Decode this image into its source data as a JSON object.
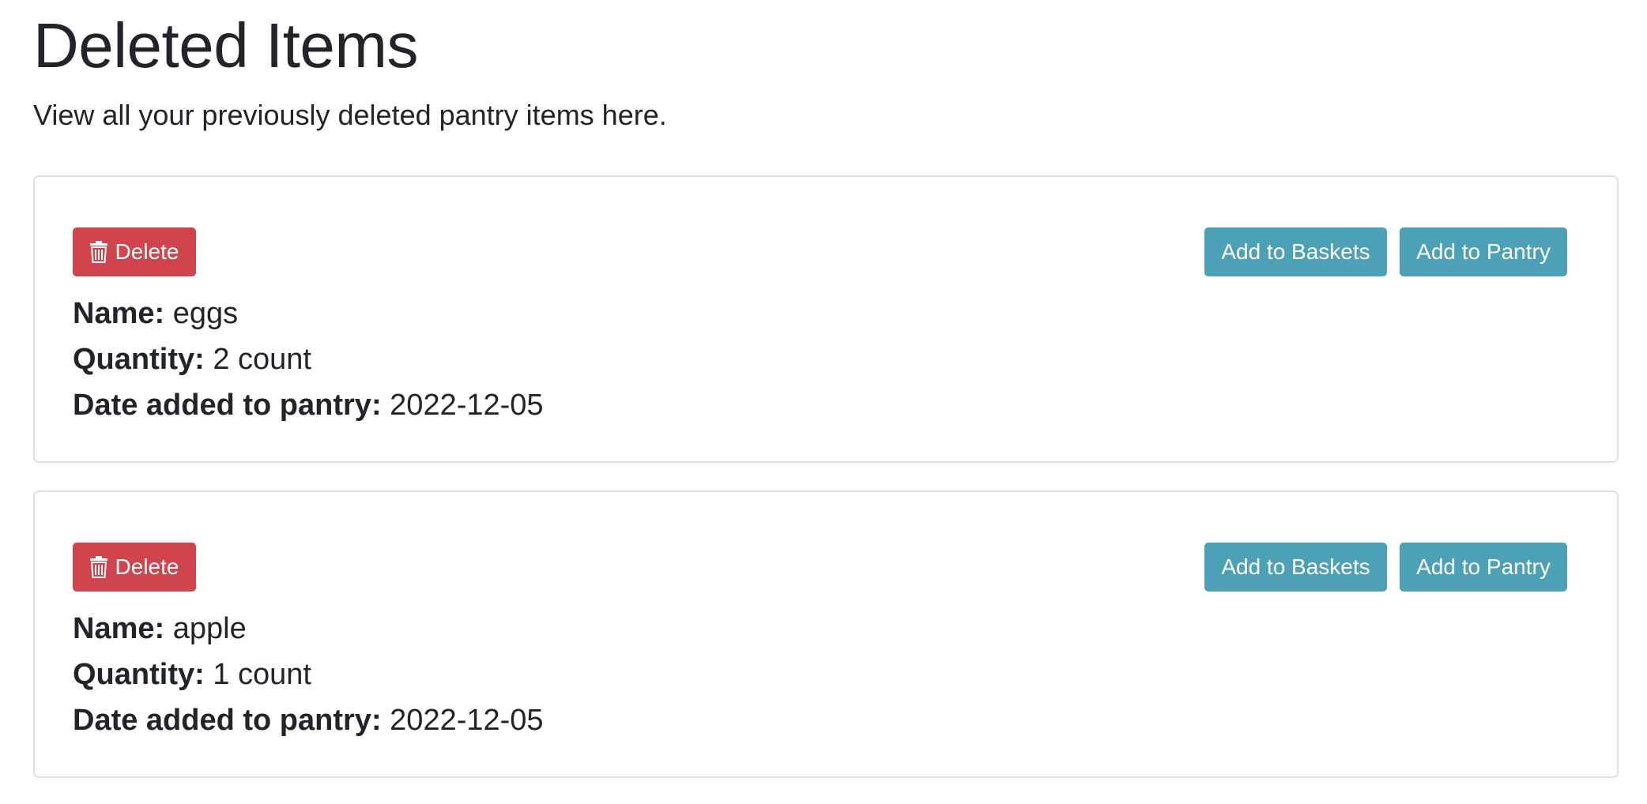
{
  "page": {
    "title": "Deleted Items",
    "subtitle": "View all your previously deleted pantry items here."
  },
  "colors": {
    "delete": "#cf444d",
    "action": "#4da1b6",
    "text": "#212529",
    "border": "#dcdfe3"
  },
  "labels": {
    "name": "Name:",
    "quantity": "Quantity:",
    "date": "Date added to pantry:"
  },
  "items": [
    {
      "name": "eggs",
      "quantity": "2 count",
      "date_added": "2022-12-05",
      "delete_label": "Delete",
      "baskets_label": "Add to Baskets",
      "pantry_label": "Add to Pantry",
      "delete_icon": "trash-icon"
    },
    {
      "name": "apple",
      "quantity": "1 count",
      "date_added": "2022-12-05",
      "delete_label": "Delete",
      "baskets_label": "Add to Baskets",
      "pantry_label": "Add to Pantry",
      "delete_icon": "trash-icon"
    }
  ]
}
